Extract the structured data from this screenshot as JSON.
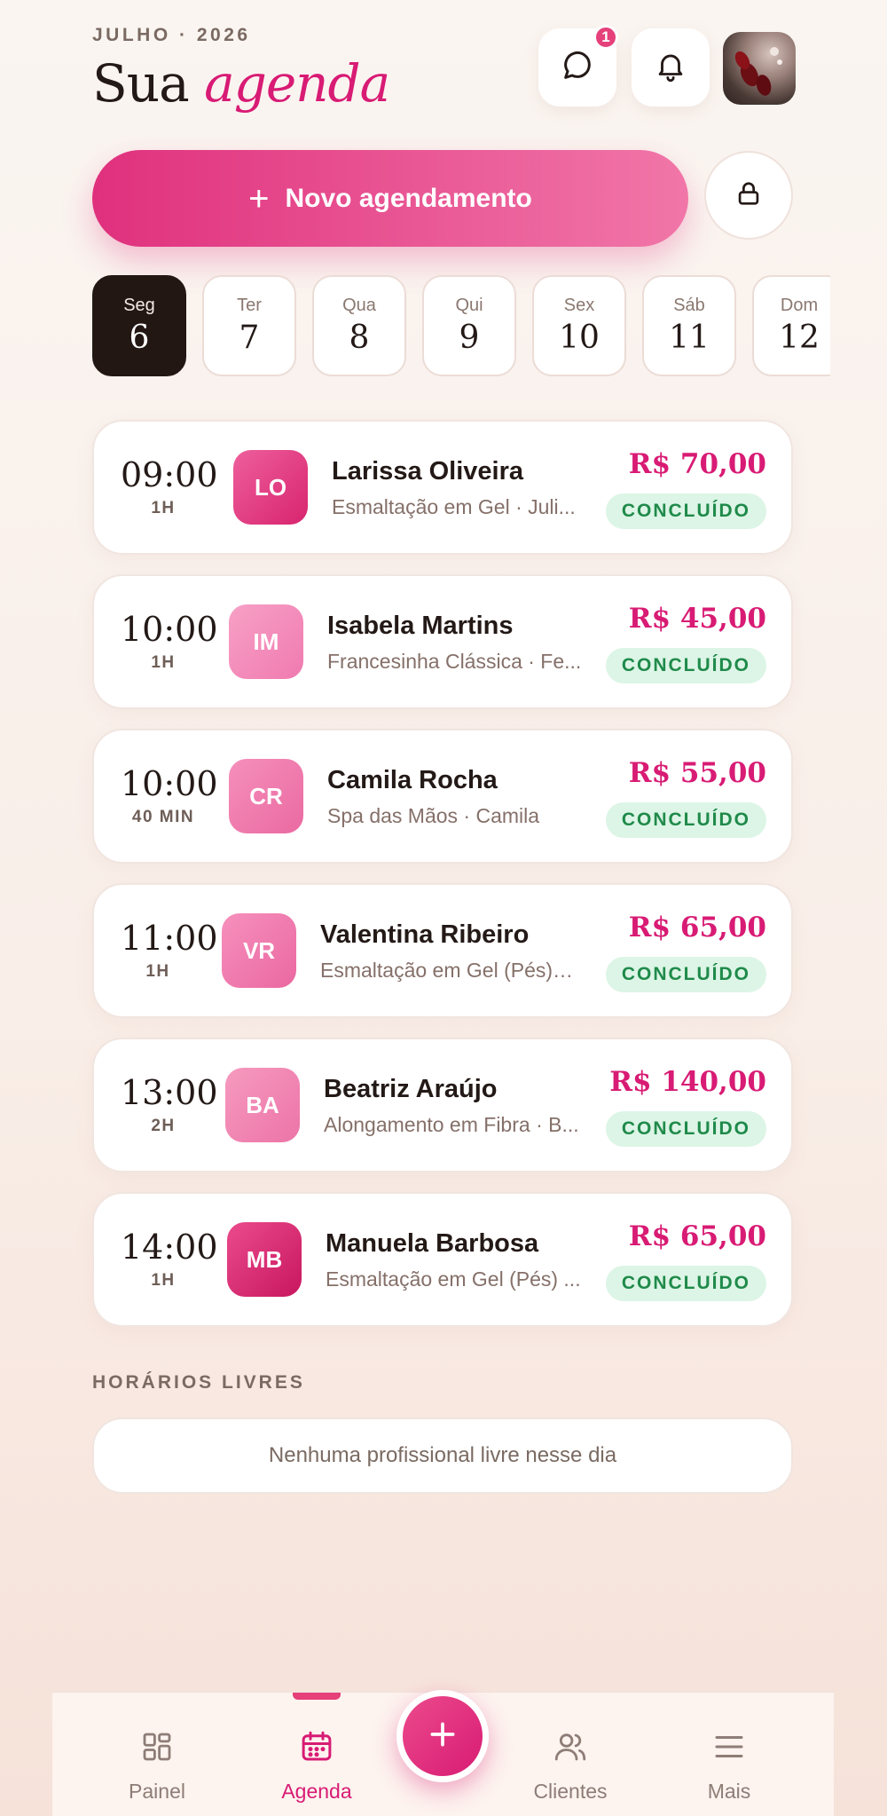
{
  "header": {
    "eyebrow": "JULHO · 2026",
    "title_plain": "Sua",
    "title_accent": "agenda",
    "chat_badge": "1"
  },
  "actions": {
    "new_appointment_label": "Novo agendamento"
  },
  "days": [
    {
      "name": "Seg",
      "num": "6",
      "active": true
    },
    {
      "name": "Ter",
      "num": "7"
    },
    {
      "name": "Qua",
      "num": "8"
    },
    {
      "name": "Qui",
      "num": "9"
    },
    {
      "name": "Sex",
      "num": "10"
    },
    {
      "name": "Sáb",
      "num": "11"
    },
    {
      "name": "Dom",
      "num": "12"
    }
  ],
  "appointments": [
    {
      "time": "09:00",
      "duration": "1H",
      "initials": "LO",
      "name": "Larissa Oliveira",
      "service": "Esmaltação em Gel · Juli...",
      "price": "R$ 70,00",
      "status": "CONCLUÍDO"
    },
    {
      "time": "10:00",
      "duration": "1H",
      "initials": "IM",
      "name": "Isabela Martins",
      "service": "Francesinha Clássica · Fe...",
      "price": "R$ 45,00",
      "status": "CONCLUÍDO"
    },
    {
      "time": "10:00",
      "duration": "40 MIN",
      "initials": "CR",
      "name": "Camila Rocha",
      "service": "Spa das Mãos · Camila",
      "price": "R$ 55,00",
      "status": "CONCLUÍDO"
    },
    {
      "time": "11:00",
      "duration": "1H",
      "initials": "VR",
      "name": "Valentina Ribeiro",
      "service": "Esmaltação em Gel (Pés) · ...",
      "price": "R$ 65,00",
      "status": "CONCLUÍDO"
    },
    {
      "time": "13:00",
      "duration": "2H",
      "initials": "BA",
      "name": "Beatriz Araújo",
      "service": "Alongamento em Fibra · B...",
      "price": "R$ 140,00",
      "status": "CONCLUÍDO"
    },
    {
      "time": "14:00",
      "duration": "1H",
      "initials": "MB",
      "name": "Manuela Barbosa",
      "service": "Esmaltação em Gel (Pés) ...",
      "price": "R$ 65,00",
      "status": "CONCLUÍDO"
    }
  ],
  "free_slots": {
    "label": "HORÁRIOS LIVRES",
    "empty_text": "Nenhuma profissional livre nesse dia"
  },
  "nav": {
    "painel": "Painel",
    "agenda": "Agenda",
    "clientes": "Clientes",
    "mais": "Mais"
  },
  "colors": {
    "accent": "#d81b74",
    "status_bg": "#dcf5e6",
    "status_text": "#1f8a4a"
  }
}
